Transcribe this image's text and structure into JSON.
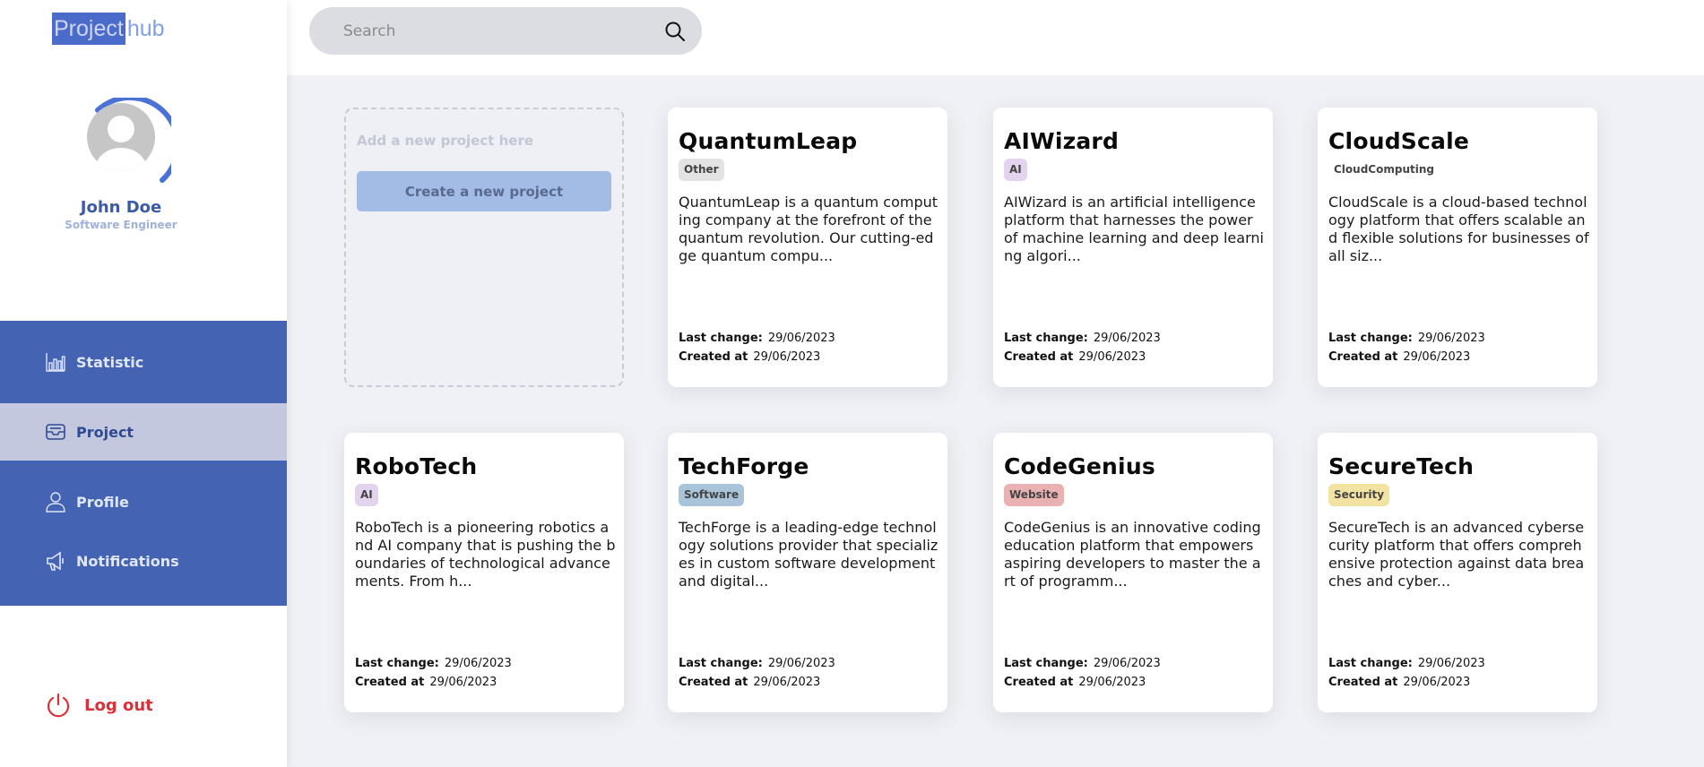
{
  "app": {
    "logo_part1": "Project",
    "logo_part2": "hub"
  },
  "user": {
    "name": "John Doe",
    "role": "Software Engineer"
  },
  "nav": {
    "items": [
      {
        "label": "Statistic",
        "icon": "bar-chart-icon",
        "active": false
      },
      {
        "label": "Project",
        "icon": "inbox-icon",
        "active": true
      },
      {
        "label": "Profile",
        "icon": "user-icon",
        "active": false
      },
      {
        "label": "Notifications",
        "icon": "megaphone-icon",
        "active": false
      }
    ],
    "logout_label": "Log out"
  },
  "search": {
    "placeholder": "Search",
    "value": ""
  },
  "new_project": {
    "hint": "Add a new project here",
    "button_label": "Create a new project"
  },
  "meta_labels": {
    "last_change": "Last change:",
    "created_at": "Created at"
  },
  "projects": [
    {
      "title": "QuantumLeap",
      "tag": "Other",
      "tag_color": "#e3e3e3",
      "description": "QuantumLeap is a quantum computing company at the forefront of the quantum revolution. Our cutting-edge quantum compu...",
      "last_change": "29/06/2023",
      "created_at": "29/06/2023"
    },
    {
      "title": "AIWizard",
      "tag": "AI",
      "tag_color": "#e3d3ef",
      "description": "AIWizard is an artificial intelligence platform that harnesses the power of machine learning and deep learning algori...",
      "last_change": "29/06/2023",
      "created_at": "29/06/2023"
    },
    {
      "title": "CloudScale",
      "tag": "CloudComputing",
      "tag_color": "#ffffff",
      "description": "CloudScale is a cloud-based technology platform that offers scalable and flexible solutions for businesses of all siz...",
      "last_change": "29/06/2023",
      "created_at": "29/06/2023"
    },
    {
      "title": "RoboTech",
      "tag": "AI",
      "tag_color": "#e3d3ef",
      "description": "RoboTech is a pioneering robotics and AI company that is pushing the boundaries of technological advancements. From h...",
      "last_change": "29/06/2023",
      "created_at": "29/06/2023"
    },
    {
      "title": "TechForge",
      "tag": "Software",
      "tag_color": "#a9c4d9",
      "description": "TechForge is a leading-edge technology solutions provider that specializes in custom software development and digital...",
      "last_change": "29/06/2023",
      "created_at": "29/06/2023"
    },
    {
      "title": "CodeGenius",
      "tag": "Website",
      "tag_color": "#eab1b3",
      "description": "CodeGenius is an innovative coding education platform that empowers aspiring developers to master the art of programm...",
      "last_change": "29/06/2023",
      "created_at": "29/06/2023"
    },
    {
      "title": "SecureTech",
      "tag": "Security",
      "tag_color": "#f3e3a3",
      "description": "SecureTech is an advanced cybersecurity platform that offers comprehensive protection against data breaches and cyber...",
      "last_change": "29/06/2023",
      "created_at": "29/06/2023"
    }
  ],
  "colors": {
    "primary": "#4463b3",
    "active_nav": "#c3c8de",
    "logout": "#d9303a",
    "user_name": "#3d5aa6"
  }
}
